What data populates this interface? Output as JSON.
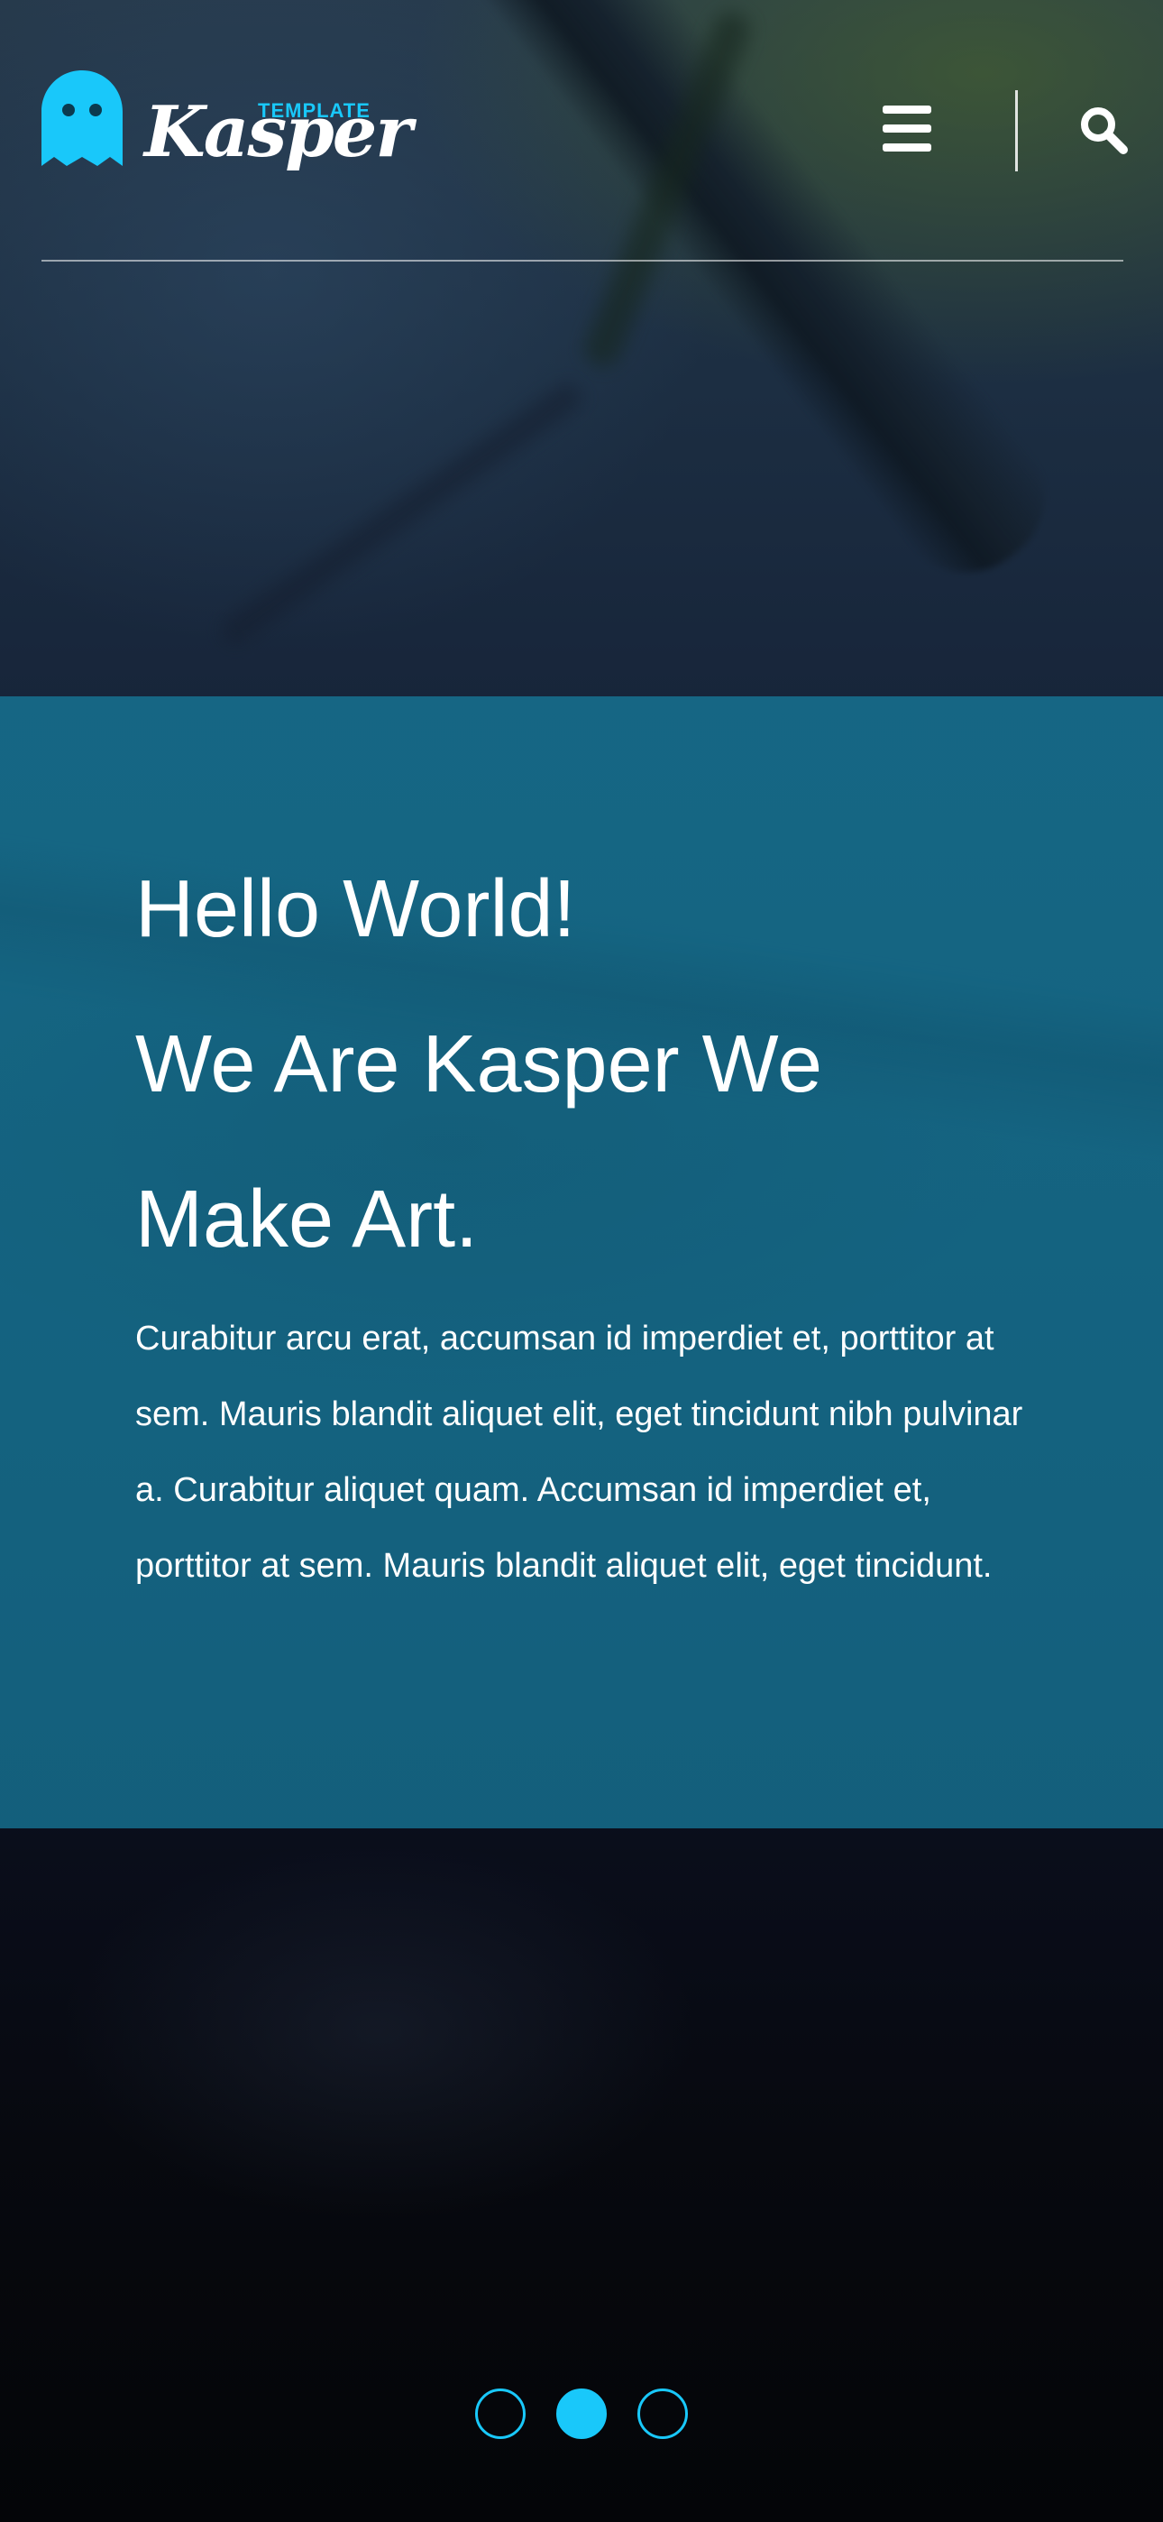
{
  "header": {
    "logo_small": "TEMPLATE",
    "logo_word": "Kasper",
    "icons": [
      "ghost-icon",
      "hamburger-menu-icon",
      "search-icon"
    ]
  },
  "hero": {
    "title_lines": [
      "Hello World!",
      "We Are Kasper We",
      "Make Art."
    ],
    "paragraph": "Curabitur arcu erat, accumsan id imperdiet et, porttitor at sem. Mauris blandit aliquet elit, eget tincidunt nibh pulvinar a. Curabitur aliquet quam. Accumsan id imperdiet et, porttitor at sem. Mauris blandit aliquet elit, eget tincidunt."
  },
  "slider": {
    "dot_count": 3,
    "active_index": 1
  },
  "colors": {
    "accent": "#19c8fa",
    "hero_panel": "#135f7c",
    "text": "#ffffff"
  }
}
